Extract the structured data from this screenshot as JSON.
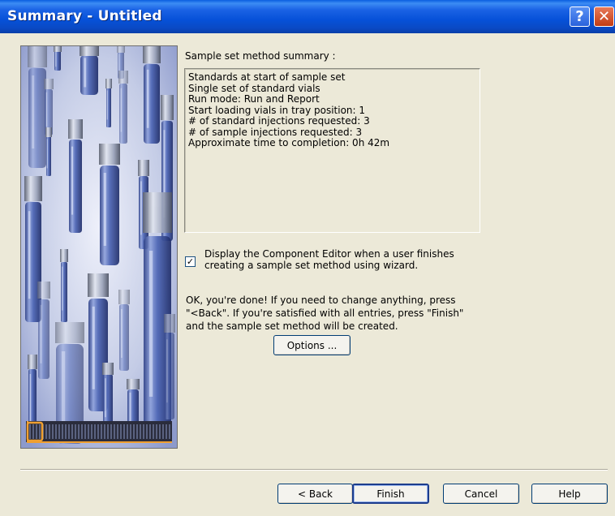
{
  "window": {
    "title": "Summary - Untitled",
    "help_glyph": "?",
    "close_glyph": "✕"
  },
  "summary": {
    "label": "Sample set method summary :",
    "lines": [
      "Standards at start of sample set",
      "Single set of standard vials",
      "Run mode: Run and Report",
      "Start loading vials in tray position: 1",
      "# of standard injections requested: 3",
      "# of sample injections requested: 3",
      "Approximate time to completion: 0h 42m"
    ]
  },
  "component_editor": {
    "checked": true,
    "check_glyph": "✓",
    "label_line1": "Display the Component Editor when a user finishes",
    "label_line2": "creating a sample set method using wizard."
  },
  "done_message": {
    "line1": "OK, you're done!  If you need to change anything, press",
    "line2": "\"<Back\".  If you're satisfied with all entries, press \"Finish\"",
    "line3": "and the sample set method will be created."
  },
  "buttons": {
    "options": "Options ...",
    "back": "< Back",
    "finish": "Finish",
    "cancel": "Cancel",
    "help": "Help"
  },
  "wizard_progress": 0.1,
  "colors": {
    "titlebar": "#0a5ee0",
    "dialog_bg": "#ece9d8",
    "art_accent": "#f0a030",
    "vial_blue": "#3c58a8"
  },
  "icons": {
    "help": "question-icon",
    "close": "close-icon",
    "checkbox": "checkmark-icon",
    "art": "vials-illustration"
  }
}
